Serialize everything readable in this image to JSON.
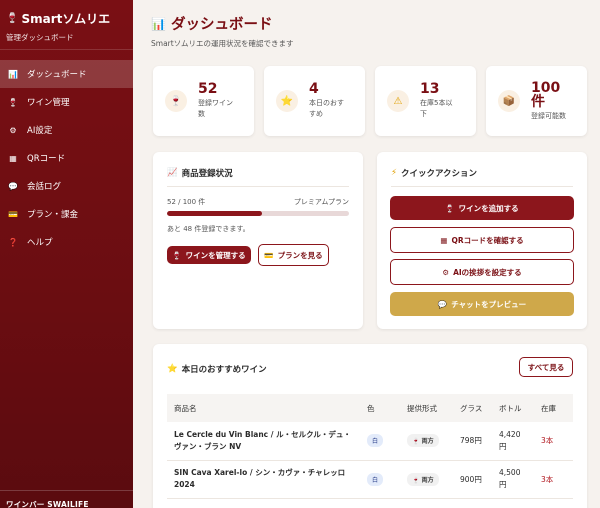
{
  "sidebar": {
    "brand_icon": "🍷",
    "brand_title": "Smartソムリエ",
    "brand_sub": "管理ダッシュボード",
    "items": [
      {
        "icon": "📊",
        "label": "ダッシュボード"
      },
      {
        "icon": "🍷",
        "label": "ワイン管理"
      },
      {
        "icon": "⚙",
        "label": "AI設定"
      },
      {
        "icon": "▦",
        "label": "QRコード"
      },
      {
        "icon": "💬",
        "label": "会話ログ"
      },
      {
        "icon": "💳",
        "label": "プラン・課金"
      },
      {
        "icon": "❓",
        "label": "ヘルプ"
      }
    ],
    "footer": "ワインバー SWAILIFE"
  },
  "header": {
    "title_icon": "📊",
    "title": "ダッシュボード",
    "subtitle": "Smartソムリエの運用状況を確認できます"
  },
  "stats": [
    {
      "icon": "🍷",
      "value": "52",
      "label_1": "登録ワイン",
      "label_2": "数"
    },
    {
      "icon": "⭐",
      "value": "4",
      "label_1": "本日のおす",
      "label_2": "すめ"
    },
    {
      "icon": "⚠",
      "value": "13",
      "label_1": "在庫5本以",
      "label_2": "下"
    },
    {
      "icon": "📦",
      "value": "100",
      "value_2": "件",
      "label_1": "登録可能数",
      "label_2": ""
    }
  ],
  "registration": {
    "icon": "📈",
    "title": "商品登録状況",
    "count": "52 / 100 件",
    "plan": "プレミアムプラン",
    "progress": 0.52,
    "remaining": "あと 48 件登録できます。",
    "manage_btn": "ワインを管理する",
    "manage_icon": "🍷",
    "plan_btn": "プランを見る",
    "plan_icon": "💳"
  },
  "quick": {
    "icon": "⚡",
    "title": "クイックアクション",
    "add_btn": "ワインを追加する",
    "add_icon": "🍷",
    "qr_btn": "QRコードを確認する",
    "qr_icon": "▦",
    "ai_btn": "AIの挨拶を設定する",
    "ai_icon": "⚙",
    "chat_btn": "チャットをプレビュー",
    "chat_icon": "💬"
  },
  "recommend": {
    "icon": "⭐",
    "title": "本日のおすすめワイン",
    "see_all": "すべて見る",
    "columns": [
      "商品名",
      "色",
      "提供形式",
      "グラス",
      "ボトル",
      "在庫"
    ],
    "rows": [
      {
        "name_1": "Le Cercle du Vin Blanc / ル・セルクル・デュ・",
        "name_2": "ヴァン・ブラン NV",
        "color": "白",
        "format_icon": "🍷",
        "format": "両方",
        "glass": "798円",
        "bottle_1": "4,420",
        "bottle_2": "円",
        "stock": "3本"
      },
      {
        "name_1": "SIN Cava Xarel-lo / シン・カヴァ・チャレッロ",
        "name_2": "2024",
        "color": "白",
        "format_icon": "🍷",
        "format": "両方",
        "glass": "900円",
        "bottle_1": "4,500",
        "bottle_2": "円",
        "stock": "3本"
      }
    ]
  }
}
